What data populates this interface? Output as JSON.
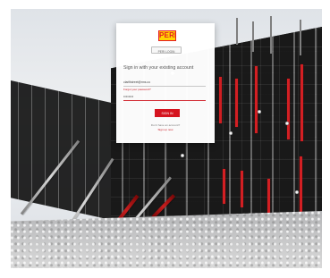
{
  "background": {
    "scene": "construction-site-formwork",
    "accent_red": "#d31f23"
  },
  "login": {
    "brand": "PERI",
    "peri_login_label": "PERI LOGIN",
    "heading": "Sign in with your existing account",
    "email_value": "clarifistreet@rms.co",
    "forgot_password": "Forgot your password?",
    "password_value": "••••••••",
    "sign_in_label": "SIGN IN",
    "no_account_text": "Don't have an account?",
    "sign_up_label": "Sign up now"
  }
}
